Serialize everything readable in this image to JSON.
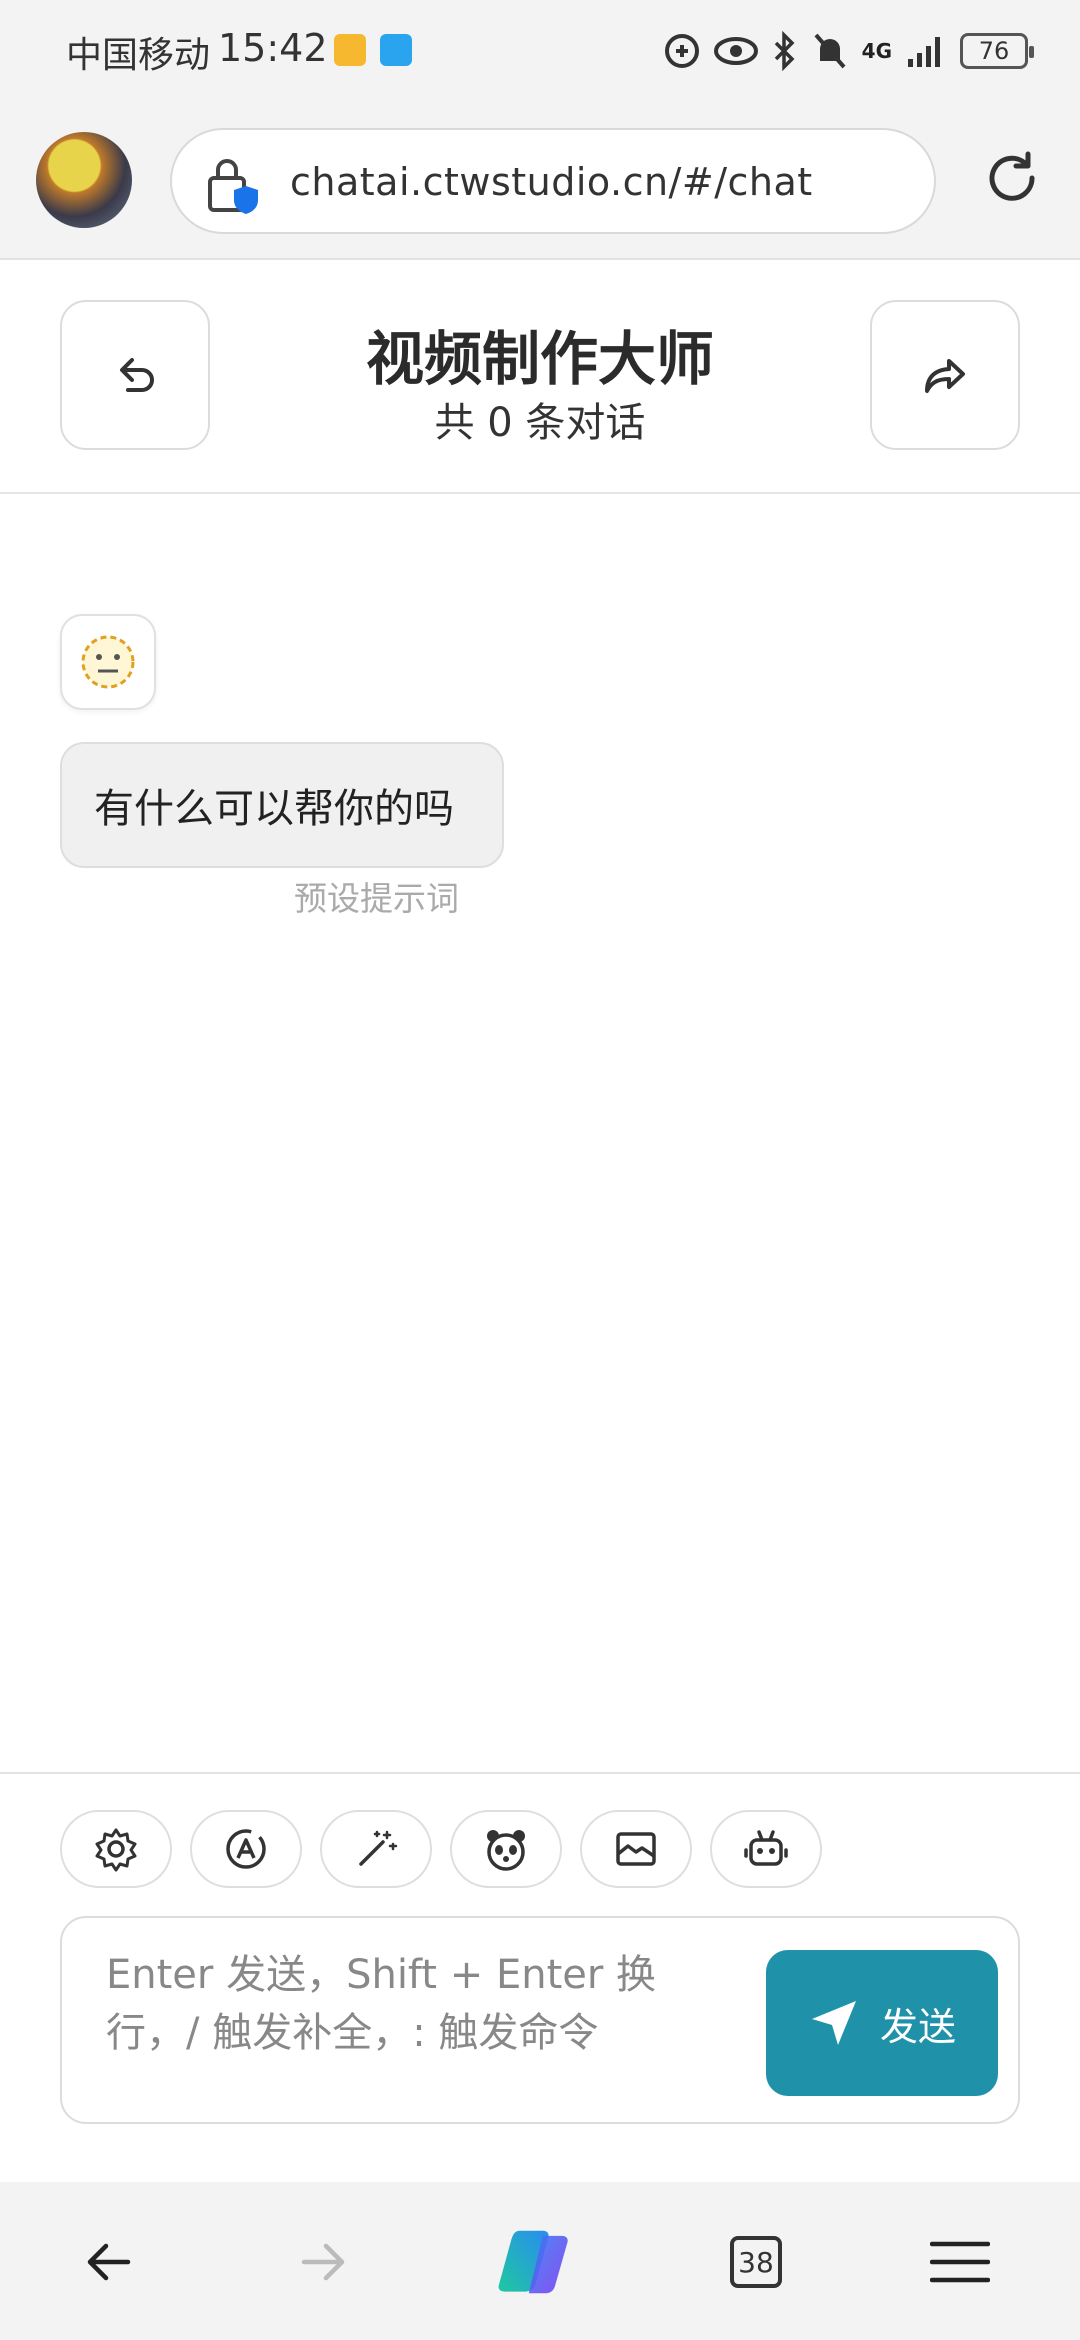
{
  "status_bar": {
    "carrier": "中国移动",
    "time": "15:42",
    "battery": "76",
    "network": "4G"
  },
  "browser": {
    "url": "chatai.ctwstudio.cn/#/chat",
    "tab_count": "38"
  },
  "chat_header": {
    "title": "视频制作大师",
    "subtitle": "共 0 条对话"
  },
  "messages": [
    {
      "role": "bot",
      "text": "有什么可以帮你的吗",
      "note": "预设提示词"
    }
  ],
  "toolbar": {
    "tools": [
      "gear-icon",
      "auto-theme-icon",
      "magic-wand-icon",
      "panda-mask-icon",
      "image-frame-icon",
      "robot-icon"
    ]
  },
  "composer": {
    "placeholder": "Enter 发送，Shift + Enter 换行，/ 触发补全，: 触发命令",
    "send_label": "发送"
  },
  "colors": {
    "accent": "#1f91a8",
    "background": "#ffffff",
    "bar": "#f3f3f3"
  }
}
